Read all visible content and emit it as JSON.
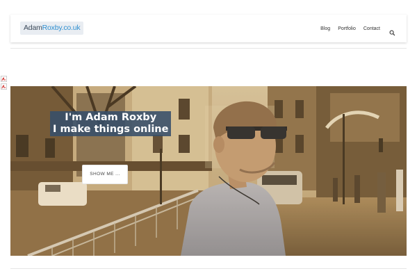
{
  "header": {
    "logo": {
      "part1": "Adam",
      "part2": "Roxby.co.uk"
    },
    "nav": [
      {
        "label": "Blog"
      },
      {
        "label": "Portfolio"
      },
      {
        "label": "Contact"
      }
    ],
    "search_icon": "search-icon"
  },
  "sidebar_icons": [
    "pdf-icon",
    "pdf-icon"
  ],
  "hero": {
    "title_line1": "I'm Adam Roxby",
    "title_line2": "I make things online",
    "button_label": "SHOW ME ..."
  },
  "colors": {
    "accent": "#2f8fd0",
    "title_bg": "#374e6a",
    "pdf_red": "#d0312d"
  }
}
